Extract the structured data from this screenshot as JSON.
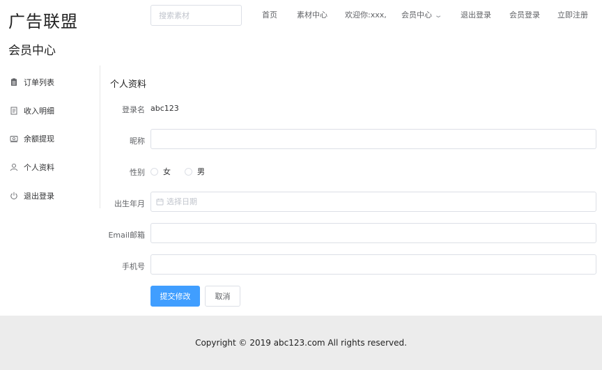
{
  "header": {
    "logo": "广告联盟",
    "search_placeholder": "搜索素材",
    "nav": {
      "home": "首页",
      "materials": "素材中心",
      "welcome": "欢迎你:xxx,",
      "member_center": "会员中心",
      "logout": "退出登录",
      "login": "会员登录",
      "register": "立即注册"
    }
  },
  "page_title": "会员中心",
  "sidebar": {
    "items": [
      {
        "label": "订单列表",
        "icon": "order-list-icon"
      },
      {
        "label": "收入明细",
        "icon": "document-icon"
      },
      {
        "label": "余额提现",
        "icon": "wallet-icon"
      },
      {
        "label": "个人资料",
        "icon": "user-icon"
      },
      {
        "label": "退出登录",
        "icon": "power-icon"
      }
    ]
  },
  "profile": {
    "section_title": "个人资料",
    "username_label": "登录名",
    "username_value": "abc123",
    "nickname_label": "昵称",
    "nickname_value": "",
    "gender_label": "性别",
    "gender_options": [
      "女",
      "男"
    ],
    "birthdate_label": "出生年月",
    "birthdate_placeholder": "选择日期",
    "email_label": "Email邮箱",
    "email_value": "",
    "phone_label": "手机号",
    "phone_value": "",
    "submit_label": "提交修改",
    "cancel_label": "取消"
  },
  "footer": {
    "copyright": "Copyright © 2019 abc123.com All rights reserved."
  },
  "colors": {
    "primary": "#409eff",
    "border": "#dcdfe6",
    "footer_bg": "#ececec"
  }
}
